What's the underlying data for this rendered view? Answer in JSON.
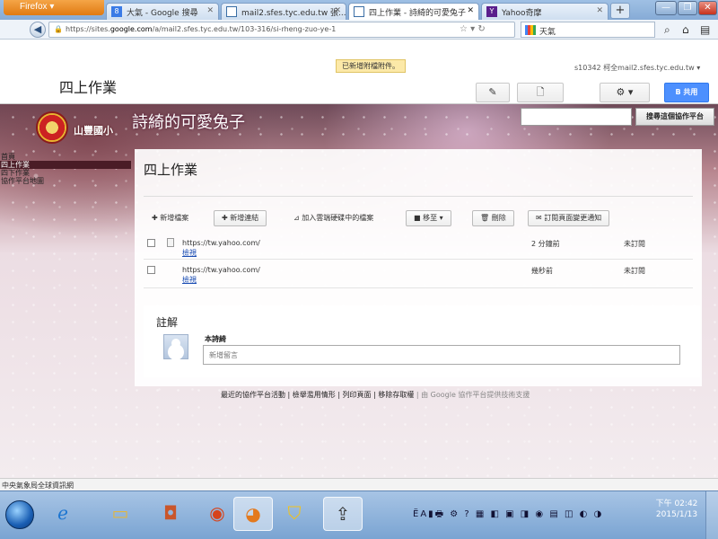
{
  "browser": {
    "menu_button": "Firefox",
    "tabs": [
      {
        "label": "大氣 - Google 搜尋",
        "active": false
      },
      {
        "label": "mail2.sfes.tyc.edu.tw 張...",
        "active": false
      },
      {
        "label": "四上作業 - 詩綺的可愛兔子",
        "active": true
      },
      {
        "label": "Yahoo奇摩",
        "active": false
      }
    ],
    "new_tab": "+",
    "url_prefix": "https://sites.",
    "url_host": "google.com",
    "url_rest": "/a/mail2.sfes.tyc.edu.tw/103-316/si-rheng-zuo-ye-1",
    "search_value": "天氣",
    "window_controls": {
      "minimize": "—",
      "restore": "❐",
      "close": "✕"
    }
  },
  "sites_header": {
    "site_title": "四上作業",
    "notice": "已新增附檔附件。",
    "account": "s10342 柯全mail2.sfes.tyc.edu.tw ▾",
    "edit_label": "✎",
    "page_label": "🗋",
    "gear_label": "⚙ ▾",
    "share_label": "B 共用"
  },
  "banner": {
    "school": "山豐國小",
    "site_name": "詩綺的可愛兔子",
    "search_button": "搜尋這個協作平台"
  },
  "sidebar": {
    "items": [
      {
        "label": "首頁",
        "active": false
      },
      {
        "label": "四上作業",
        "active": true
      },
      {
        "label": "四下作業",
        "active": false
      },
      {
        "label": "協作平台地圖",
        "active": false
      }
    ]
  },
  "content": {
    "title": "四上作業",
    "toolbar": {
      "add_file": "✚ 新增檔案",
      "add_link": "✚ 新增連結",
      "add_from_drive": "⊿ 加入雲端硬碟中的檔案",
      "move": "■ 移至 ▾",
      "delete": "🗑 刪除",
      "subscribe": "✉ 訂閱頁面變更通知"
    },
    "files": [
      {
        "url": "https://tw.yahoo.com/",
        "desc": "檢視",
        "time": "2 分鐘前",
        "version": "未訂閱"
      },
      {
        "url": "https://tw.yahoo.com/",
        "desc": "檢視",
        "time": "幾秒前",
        "version": "未訂閱"
      }
    ]
  },
  "comments": {
    "title": "註解",
    "commenter": "本詩綺",
    "placeholder": "新增留言"
  },
  "footer": {
    "links": "最近的協作平台活動 | 檢舉濫用情形 | 列印頁面 | 移除存取權",
    "powered": "由 Google 協作平台提供技術支援"
  },
  "statusbar": {
    "text": "中央氣象局全球資訊網"
  },
  "taskbar": {
    "clock_time": "下午 02:42",
    "clock_date": "2015/1/13",
    "tray": "ЁA▮🖶 ⚙ ? ▦ ◧ ▣ ◨ ◉ ▤ ◫ ◐ ◑"
  },
  "colors": {
    "share_button": "#4d90fe",
    "sidebar_active": "#4a1c26",
    "taskbar": "#7aa4d2"
  }
}
